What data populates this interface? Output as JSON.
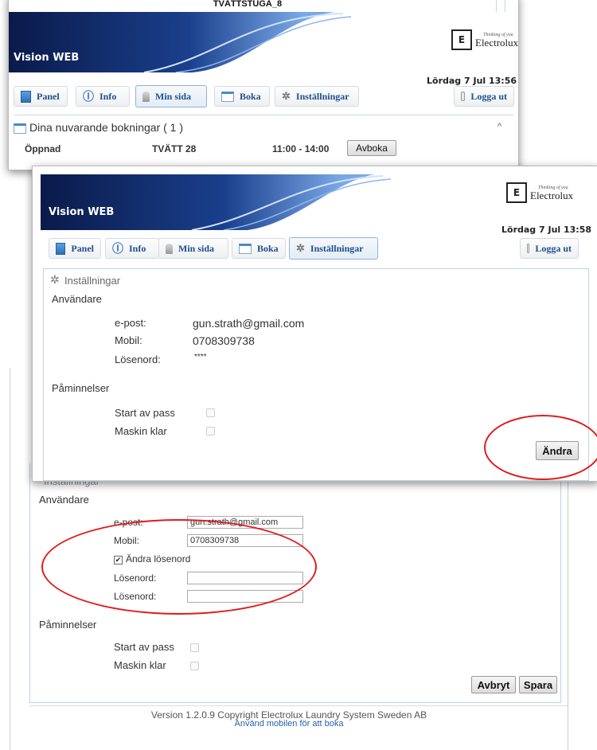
{
  "colors": {
    "brand_navy": "#0b1f54",
    "link_blue": "#1e4f8c",
    "highlight_red": "#e11b1b"
  },
  "app": {
    "name": "Vision WEB"
  },
  "logo": {
    "brand": "Electrolux",
    "tagline": "Thinking of you"
  },
  "top_strip": {
    "title": "TVÄTTSTUGA_8"
  },
  "nav": {
    "panel": "Panel",
    "info": "Info",
    "min_sida": "Min sida",
    "boka": "Boka",
    "installningar": "Inställningar",
    "logga_ut": "Logga ut"
  },
  "window1": {
    "date": "Lördag 7 Jul 13:56",
    "active_tab": "Min sida",
    "bookings_header": "Dina nuvarande bokningar ( 1 )",
    "bookings": [
      {
        "status": "Öppnad",
        "machine": "TVÄTT 28",
        "time": "11:00 - 14:00",
        "action": "Avboka"
      }
    ]
  },
  "window2": {
    "date": "Lördag 7 Jul 13:58",
    "active_tab": "Inställningar",
    "section_title": "Inställningar",
    "user_heading": "Användare",
    "email_label": "e-post:",
    "email_value": "gun.strath@gmail.com",
    "mobile_label": "Mobil:",
    "mobile_value": "0708309738",
    "password_label": "Lösenord:",
    "password_value": "****",
    "reminders_heading": "Påminnelser",
    "start_label": "Start av pass",
    "machine_ready_label": "Maskin klar",
    "change_button": "Ändra"
  },
  "window3": {
    "section_title": "Inställningar",
    "user_heading": "Användare",
    "email_label": "e-post:",
    "email_value": "gun.strath@gmail.com",
    "mobile_label": "Mobil:",
    "mobile_value": "0708309738",
    "change_password_label": "Ändra lösenord",
    "change_password_checked": true,
    "password_label_1": "Lösenord:",
    "password_label_2": "Lösenord:",
    "reminders_heading": "Påminnelser",
    "start_label": "Start av pass",
    "machine_ready_label": "Maskin klar",
    "cancel_button": "Avbryt",
    "save_button": "Spara",
    "footer_version": "Version 1.2.0.9 Copyright Electrolux Laundry System Sweden AB",
    "footer_link": "Använd mobilen för att boka"
  }
}
